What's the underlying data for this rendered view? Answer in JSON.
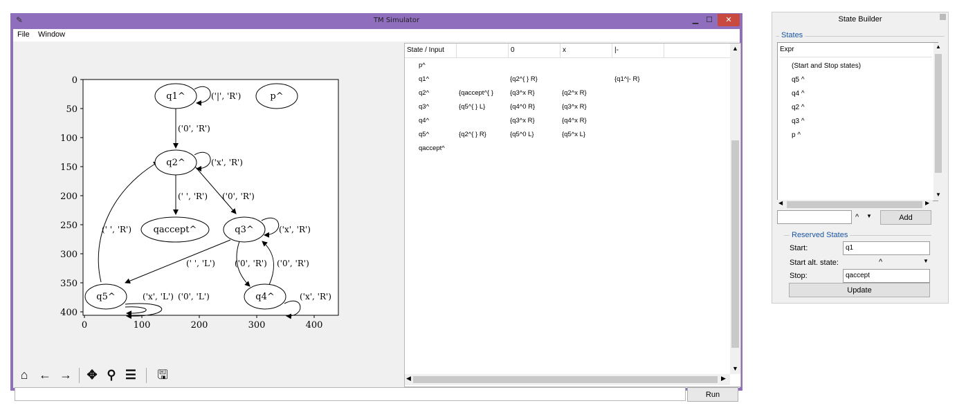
{
  "window": {
    "title": "TM Simulator",
    "icon": "feather-icon"
  },
  "menu": [
    {
      "label": "File"
    },
    {
      "label": "Window"
    }
  ],
  "plot": {
    "y_ticks": [
      "0",
      "50",
      "100",
      "150",
      "200",
      "250",
      "300",
      "350",
      "400"
    ],
    "x_ticks": [
      "0",
      "100",
      "200",
      "300",
      "400"
    ],
    "nodes": {
      "q1": "q1^",
      "p": "p^",
      "q2": "q2^",
      "qaccept": "qaccept^",
      "q3": "q3^",
      "q5": "q5^",
      "q4": "q4^"
    },
    "edge_labels": {
      "q1_self": "('|', 'R')",
      "q1_q2": "('0', 'R')",
      "q2_self": "('x', 'R')",
      "q2_qaccept": "(' ', 'R')",
      "q2_q3": "('0', 'R')",
      "q5_q2": "(' ', 'R')",
      "q3_self": "('x', 'R')",
      "q3_q5": "(' ', 'L')",
      "q3_q4": "('0', 'R')",
      "q4_q3": "('0', 'R')",
      "q5_self_x": "('x', 'L')",
      "q5_self_0": "('0', 'L')",
      "q4_self": "('x', 'R')"
    }
  },
  "toolbar": [
    {
      "icon": "home-icon",
      "glyph": "⌂"
    },
    {
      "icon": "back-arrow-icon",
      "glyph": "←"
    },
    {
      "icon": "forward-arrow-icon",
      "glyph": "→"
    },
    {
      "icon": "pan-icon",
      "glyph": "✥"
    },
    {
      "icon": "zoom-icon",
      "glyph": "⚲"
    },
    {
      "icon": "configure-subplots-icon",
      "glyph": "☰"
    },
    {
      "icon": "save-icon",
      "glyph": "🖫"
    }
  ],
  "table": {
    "headers": [
      "State / Input",
      "",
      "0",
      "x",
      "|-"
    ],
    "rows": [
      [
        "p^",
        "",
        "",
        "",
        ""
      ],
      [
        "q1^",
        "",
        "{q2^{ } R}",
        "",
        "{q1^|- R}"
      ],
      [
        "q2^",
        "{qaccept^{ }",
        "{q3^x R}",
        "{q2^x R}",
        ""
      ],
      [
        "q3^",
        "{q5^{ } L}",
        "{q4^0 R}",
        "{q3^x R}",
        ""
      ],
      [
        "q4^",
        "",
        "{q3^x R}",
        "{q4^x R}",
        ""
      ],
      [
        "q5^",
        "{q2^{ } R}",
        "{q5^0 L}",
        "{q5^x L}",
        ""
      ],
      [
        "qaccept^",
        "",
        "",
        "",
        ""
      ]
    ]
  },
  "run_label": "Run",
  "builder": {
    "title": "State Builder",
    "states_legend": "States",
    "list_header": "Expr",
    "items": [
      "(Start and Stop states)",
      "q5 ^",
      "q4 ^",
      "q2 ^",
      "q3 ^",
      "p ^"
    ],
    "symbol_value": "^",
    "add_label": "Add",
    "reserved_legend": "Reserved States",
    "start_label": "Start:",
    "start_value": "q1",
    "alt_label": "Start alt. state:",
    "alt_value": "^",
    "stop_label": "Stop:",
    "stop_value": "qaccept",
    "update_label": "Update"
  }
}
